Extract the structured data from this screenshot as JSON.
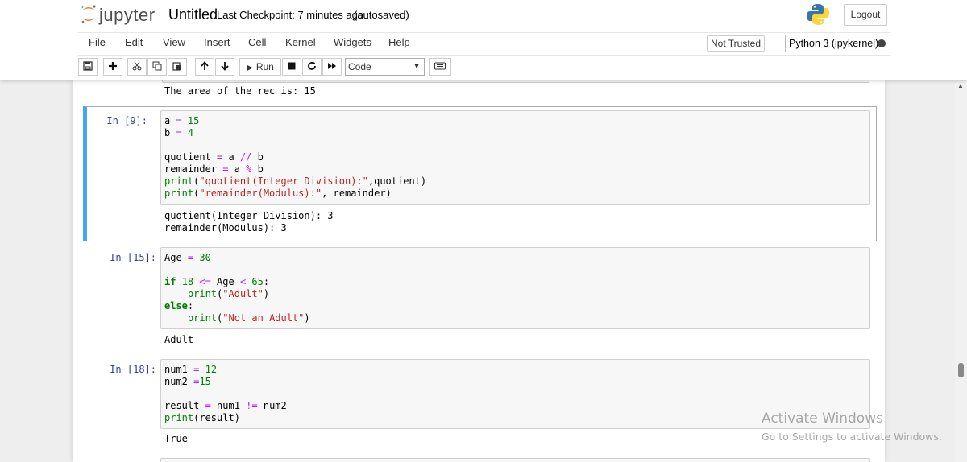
{
  "header": {
    "logo_text": "jupyter",
    "notebook_title": "Untitled",
    "checkpoint": "Last Checkpoint: 7 minutes ago",
    "autosave": "(autosaved)",
    "logout_label": "Logout"
  },
  "menu": {
    "items": [
      "File",
      "Edit",
      "View",
      "Insert",
      "Cell",
      "Kernel",
      "Widgets",
      "Help"
    ],
    "trust_label": "Not Trusted",
    "kernel_label": "Python 3 (ipykernel)"
  },
  "toolbar": {
    "run_label": "Run",
    "cell_type": "Code",
    "buttons": [
      "save-icon",
      "add-cell-icon",
      "cut-icon",
      "copy-icon",
      "paste-icon",
      "move-up-icon",
      "move-down-icon",
      "run-icon",
      "stop-icon",
      "restart-icon",
      "fast-forward-icon",
      "keyboard-icon"
    ]
  },
  "cells": [
    {
      "prompt": "",
      "input": "",
      "output": "The area of the rec is: 15"
    },
    {
      "prompt": "In [9]:",
      "input": "a = 15\nb = 4\n\nquotient = a // b\nremainder = a % b\nprint(\"quotient(Integer Division):\",quotient)\nprint(\"remainder(Modulus):\", remainder)",
      "output": "quotient(Integer Division): 3\nremainder(Modulus): 3"
    },
    {
      "prompt": "In [15]:",
      "input": "Age = 30\n\nif 18 <= Age < 65:\n    print(\"Adult\")\nelse:\n    print(\"Not an Adult\")",
      "output": "Adult"
    },
    {
      "prompt": "In [18]:",
      "input": "num1 = 12\nnum2 =15\n\nresult = num1 != num2\nprint(result)",
      "output": "True"
    }
  ],
  "watermark": {
    "title": "Activate Windows",
    "subtitle": "Go to Settings to activate Windows."
  },
  "colors": {
    "selected_cell_border": "#42a5f5",
    "prompt": "#303f9f",
    "keyword_number": "#008000",
    "operator": "#aa22ff",
    "string": "#ba2121"
  }
}
